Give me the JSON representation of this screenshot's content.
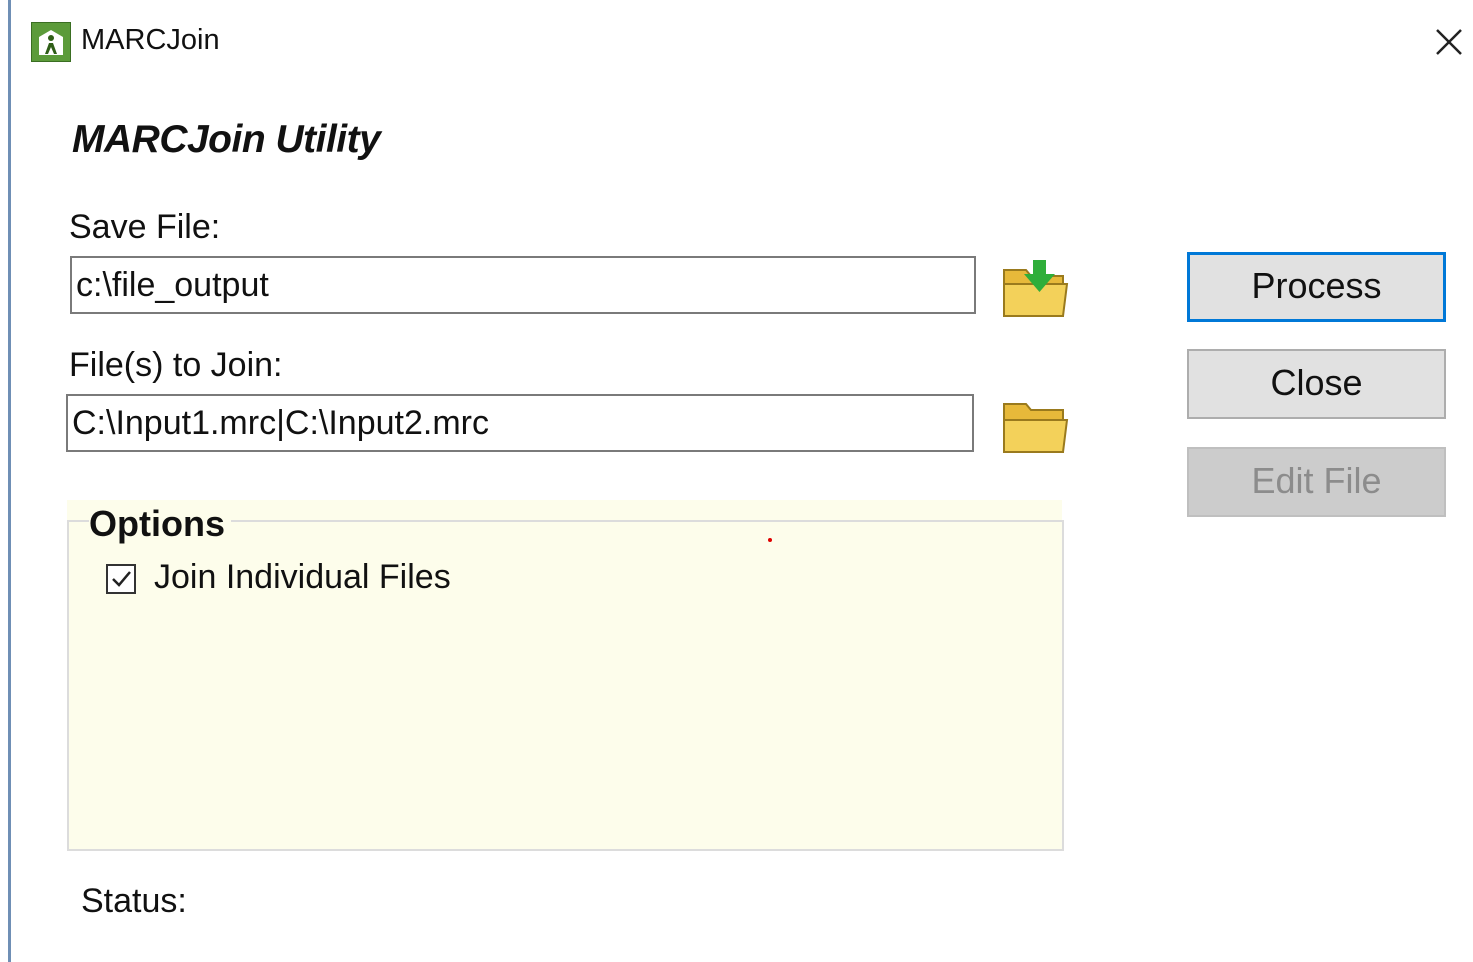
{
  "window": {
    "title": "MARCJoin",
    "close_glyph": "✕"
  },
  "form": {
    "heading": "MARCJoin Utility",
    "save_file_label": "Save File:",
    "save_file_value": "c:\\file_output",
    "files_to_join_label": "File(s) to Join:",
    "files_to_join_value": "C:\\Input1.mrc|C:\\Input2.mrc"
  },
  "buttons": {
    "process": "Process",
    "close": "Close",
    "edit_file": "Edit File"
  },
  "options": {
    "legend": "Options",
    "join_individual_files_label": "Join Individual Files",
    "join_individual_files_checked": true
  },
  "status": {
    "label": "Status:"
  },
  "icons": {
    "app": "app-icon",
    "save_browse": "folder-save-icon",
    "open_browse": "folder-open-icon"
  },
  "colors": {
    "options_background": "#fdfdeb",
    "primary_border": "#0078d7",
    "app_icon_green": "#5c9b3a",
    "folder_yellow": "#f3d15a"
  }
}
